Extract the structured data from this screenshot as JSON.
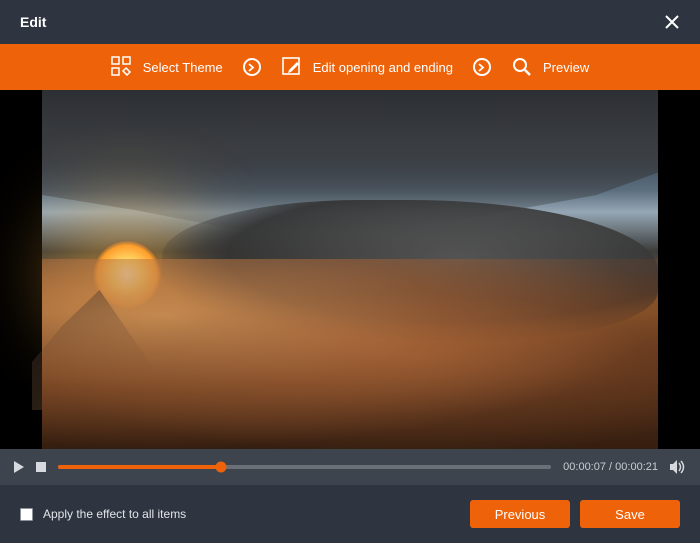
{
  "title": "Edit",
  "steps": {
    "theme_label": "Select Theme",
    "opening_label": "Edit opening and ending",
    "preview_label": "Preview"
  },
  "playback": {
    "current_time": "00:00:07",
    "total_time": "00:00:21",
    "separator": "/",
    "progress_percent": 33
  },
  "footer": {
    "apply_all_label": "Apply the effect to all items",
    "previous_label": "Previous",
    "save_label": "Save"
  },
  "colors": {
    "accent": "#ee6209",
    "window": "#2e3440",
    "controls": "#3d444d"
  }
}
